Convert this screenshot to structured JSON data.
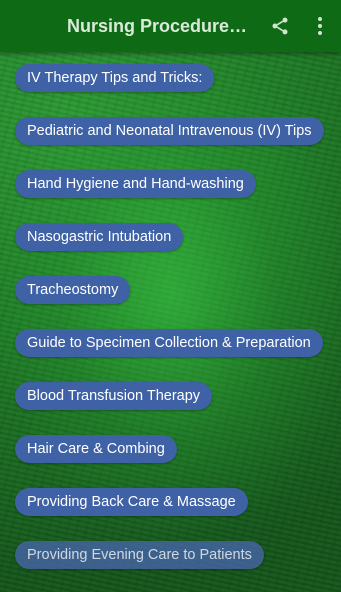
{
  "appbar": {
    "title": "Nursing Procedures...",
    "menu_icon": "hamburger-menu-icon",
    "share_icon": "share-icon",
    "more_icon": "more-vert-icon"
  },
  "colors": {
    "appbar_bg": "#0f6a16",
    "pill_bg": "#3f62a6",
    "pill_text": "#ffffff",
    "background": "#1e7a25"
  },
  "topics": [
    {
      "label": "IV Therapy Tips and Tricks:"
    },
    {
      "label": "Pediatric and Neonatal Intravenous (IV) Tips"
    },
    {
      "label": "Hand Hygiene and Hand-washing"
    },
    {
      "label": "Nasogastric Intubation"
    },
    {
      "label": "Tracheostomy"
    },
    {
      "label": "Guide to Specimen Collection & Preparation"
    },
    {
      "label": "Blood Transfusion Therapy"
    },
    {
      "label": "Hair Care & Combing"
    },
    {
      "label": "Providing Back Care & Massage"
    },
    {
      "label": "Providing Evening Care to Patients"
    }
  ]
}
